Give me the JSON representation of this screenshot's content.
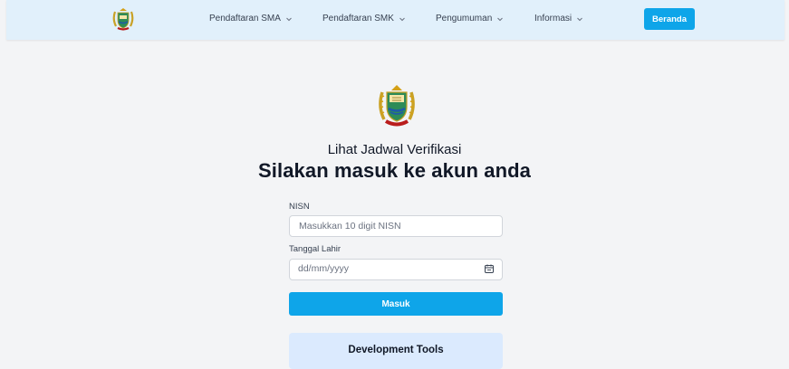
{
  "nav": {
    "logo": "provincial-emblem-icon",
    "items": [
      {
        "label": "Pendaftaran SMA",
        "icon": "chevron-down-icon"
      },
      {
        "label": "Pendaftaran SMK",
        "icon": "chevron-down-icon"
      },
      {
        "label": "Pengumuman",
        "icon": "chevron-down-icon"
      },
      {
        "label": "Informasi",
        "icon": "chevron-down-icon"
      }
    ],
    "home_button": "Beranda"
  },
  "page": {
    "logo": "provincial-emblem-icon",
    "subtitle": "Lihat Jadwal Verifikasi",
    "title": "Silakan masuk ke akun anda"
  },
  "form": {
    "nisn_label": "NISN",
    "nisn_placeholder": "Masukkan 10 digit NISN",
    "dob_label": "Tanggal Lahir",
    "dob_placeholder": "dd/mm/yyyy",
    "dob_icon": "calendar-icon",
    "submit_label": "Masuk"
  },
  "dev_tools": {
    "title": "Development Tools"
  },
  "colors": {
    "navbar_bg": "#e1f0fb",
    "accent": "#0ea5e9",
    "page_bg": "#f3f4f6",
    "dev_box_bg": "#dbeafe"
  }
}
